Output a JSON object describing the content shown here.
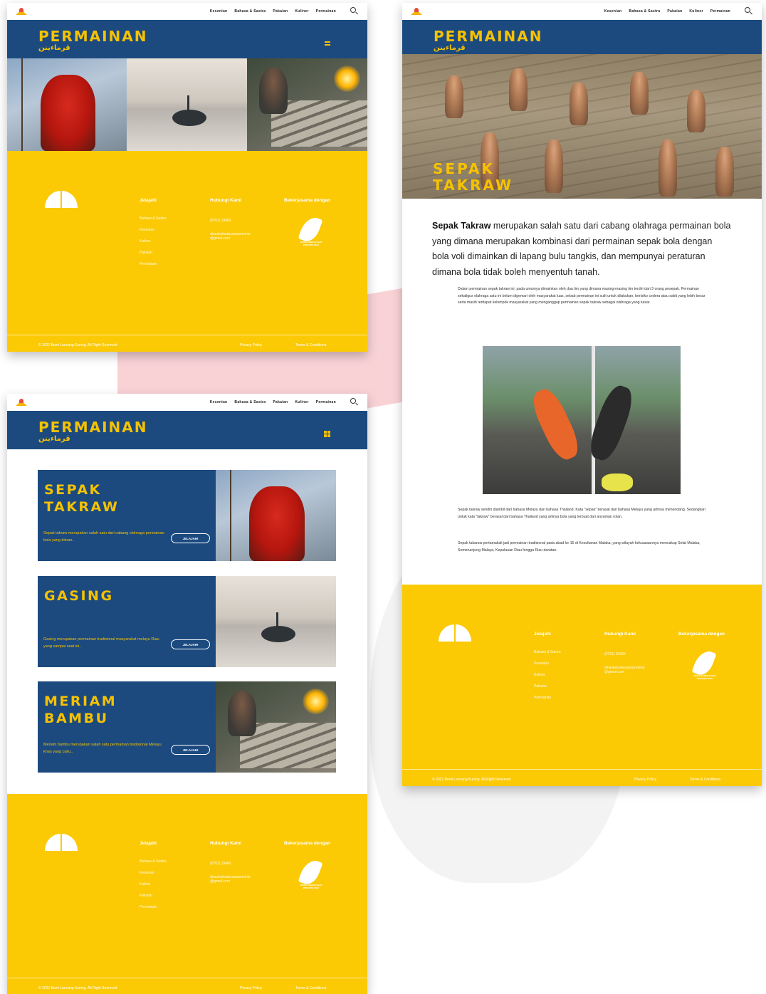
{
  "nav": {
    "links": [
      "Kesenian",
      "Bahasa & Sastra",
      "Pakaian",
      "Kuliner",
      "Permainan"
    ]
  },
  "header": {
    "title": "PERMAINAN",
    "arabic": "ڤرماءينن"
  },
  "cards": [
    {
      "title": "SEPAK\nTAKRAW",
      "desc": "Sepak takraw merupakan salah satu dari cabang olahraga permainan bola yang diman..",
      "button": "JELAJAHI"
    },
    {
      "title": "GASING",
      "desc": "Gasing merupakan permainan tradisional masyarakat melayu Riau yang sampai saat ini..",
      "button": "JELAJAHI"
    },
    {
      "title": "MERIAM\nBAMBU",
      "desc": "Meriam bambu merupakan salah satu permainan tradisional Melayu khas yang cuku..",
      "button": "JELAJAHI"
    }
  ],
  "article": {
    "title": "SEPAK\nTAKRAW",
    "lead_bold": "Sepak Takraw",
    "lead_rest": " merupakan salah satu dari cabang olahraga permainan bola yang dimana merupakan kombinasi dari permainan sepak bola dengan bola voli dimainkan di lapang bulu tangkis, dan mempunyai peraturan dimana bola tidak boleh menyentuh tanah.",
    "p1": "Dalam permainan sepak takraw ini, pada umumya dimainkan oleh dua tim yang dimana masing-masing tim terdiri dari 3 orang pesepak. Permainan sekaligus olahraga satu ini belum digemari oleh masyarakat luas, sebab permainan ini sulit untuk dilakukan, berisiko cedera atau sakit yang lebih besar serta masih terdapat kelompok masyarakat yang menganggap permainan sepak takraw sebagai olahraga yang kasar.",
    "p2": "Sepak takraw sendiri diambil dari bahasa Melayu dan bahasa Thailand. Kata \"sepak\" berasal dari bahasa Melayu yang artinya menendang. Sedangkan untuk kata \"takraw\" berasal dari bahasa Thailand yang artinya bola yang terbuat dari anyaman rotan.",
    "p3": "Sepak takaraw pertamakali jadi permainan tradisional pada abad ke-15 di Kesultanan Malaka, yang wilayah kekuasaannya mencakup Selat Malaka, Semenanjung Malaya, Kepulauan Riau hingga Riau daratan."
  },
  "footer": {
    "col1_title": "Jelajahi",
    "col1_items": [
      "Bahasa & Sastra",
      "Kesenian",
      "Kuliner",
      "Pakaian",
      "Permainan"
    ],
    "col2_title": "Hubungi Kami",
    "phone": "(0761) 33466",
    "email_1": "dinaskebudayaanprovinsi",
    "email_2": "@gmail.com",
    "col3_title": "Bekerjasama dengan",
    "partner": "DINAS KEBUDAYAAN PROVINSI RIAU",
    "copyright": "© 2022 Bumi Lancang Kuning. All Right Reserved",
    "privacy": "Privacy Policy",
    "terms": "Terms & Conditions"
  },
  "colors": {
    "navy": "#1c4a7f",
    "yellow": "#fbca05",
    "accent": "#f6c200"
  }
}
